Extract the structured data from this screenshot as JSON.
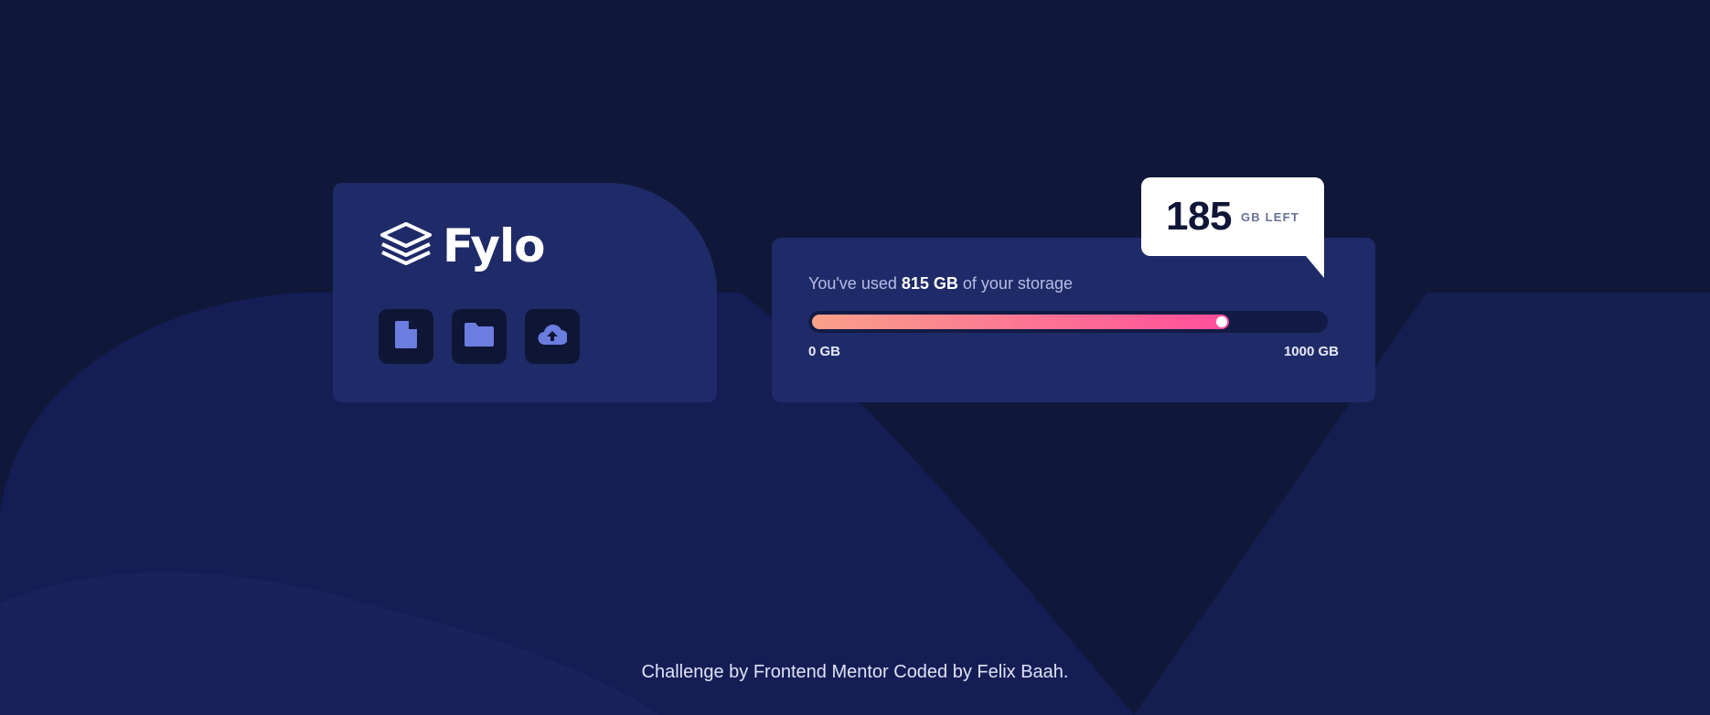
{
  "brand": {
    "name": "Fylo",
    "logo_icon": "stacked-layers-icon"
  },
  "actions": [
    {
      "icon": "document-icon"
    },
    {
      "icon": "folder-icon"
    },
    {
      "icon": "cloud-upload-icon"
    }
  ],
  "storage": {
    "used_prefix": "You've used ",
    "used_amount": "815 GB",
    "used_suffix": " of your storage",
    "min_label": "0 GB",
    "max_label": "1000 GB",
    "used_fraction": 0.815,
    "remaining_value": "185",
    "remaining_label": "GB LEFT"
  },
  "footer": {
    "credit": "Challenge by Frontend Mentor Coded by Felix Baah."
  },
  "colors": {
    "background": "#0f1838",
    "card": "#1f2b68",
    "icon_button": "#0f1535",
    "icon_accent": "#6c7de0",
    "gradient_start": "#f9a08a",
    "gradient_end": "#ff4e9b"
  }
}
